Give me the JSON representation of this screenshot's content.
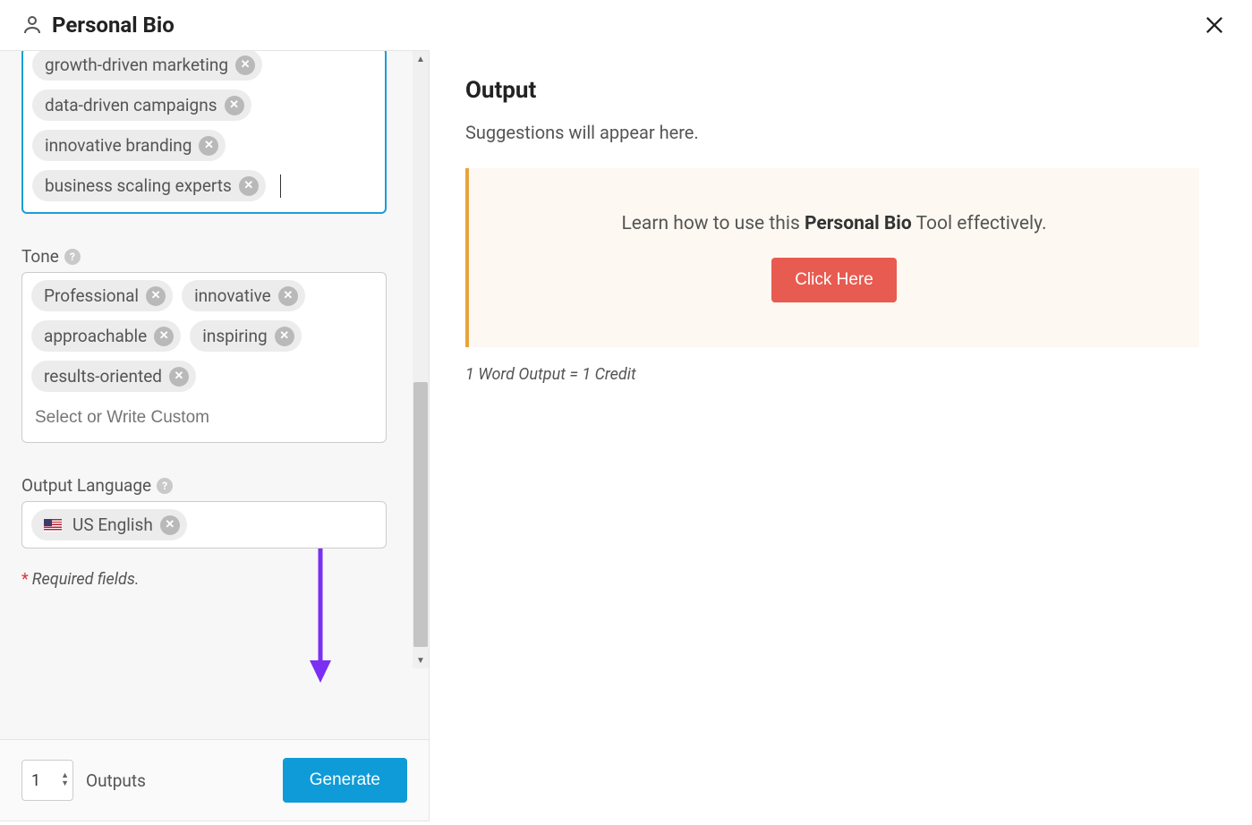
{
  "header": {
    "title": "Personal Bio"
  },
  "keywords": {
    "tags": [
      "growth-driven marketing",
      "data-driven campaigns",
      "innovative branding",
      "business scaling experts"
    ]
  },
  "tone": {
    "label": "Tone",
    "tags": [
      "Professional",
      "innovative",
      "approachable",
      "inspiring",
      "results-oriented"
    ],
    "placeholder": "Select or Write Custom"
  },
  "language": {
    "label": "Output Language",
    "value": "US English"
  },
  "required_note": "Required fields.",
  "outputs": {
    "value": "1",
    "label": "Outputs"
  },
  "generate_label": "Generate",
  "output": {
    "title": "Output",
    "suggestions": "Suggestions will appear here.",
    "tip_prefix": "Learn how to use this ",
    "tip_bold": "Personal Bio",
    "tip_suffix": " Tool effectively.",
    "cta": "Click Here",
    "credit_note": "1 Word Output = 1 Credit"
  }
}
